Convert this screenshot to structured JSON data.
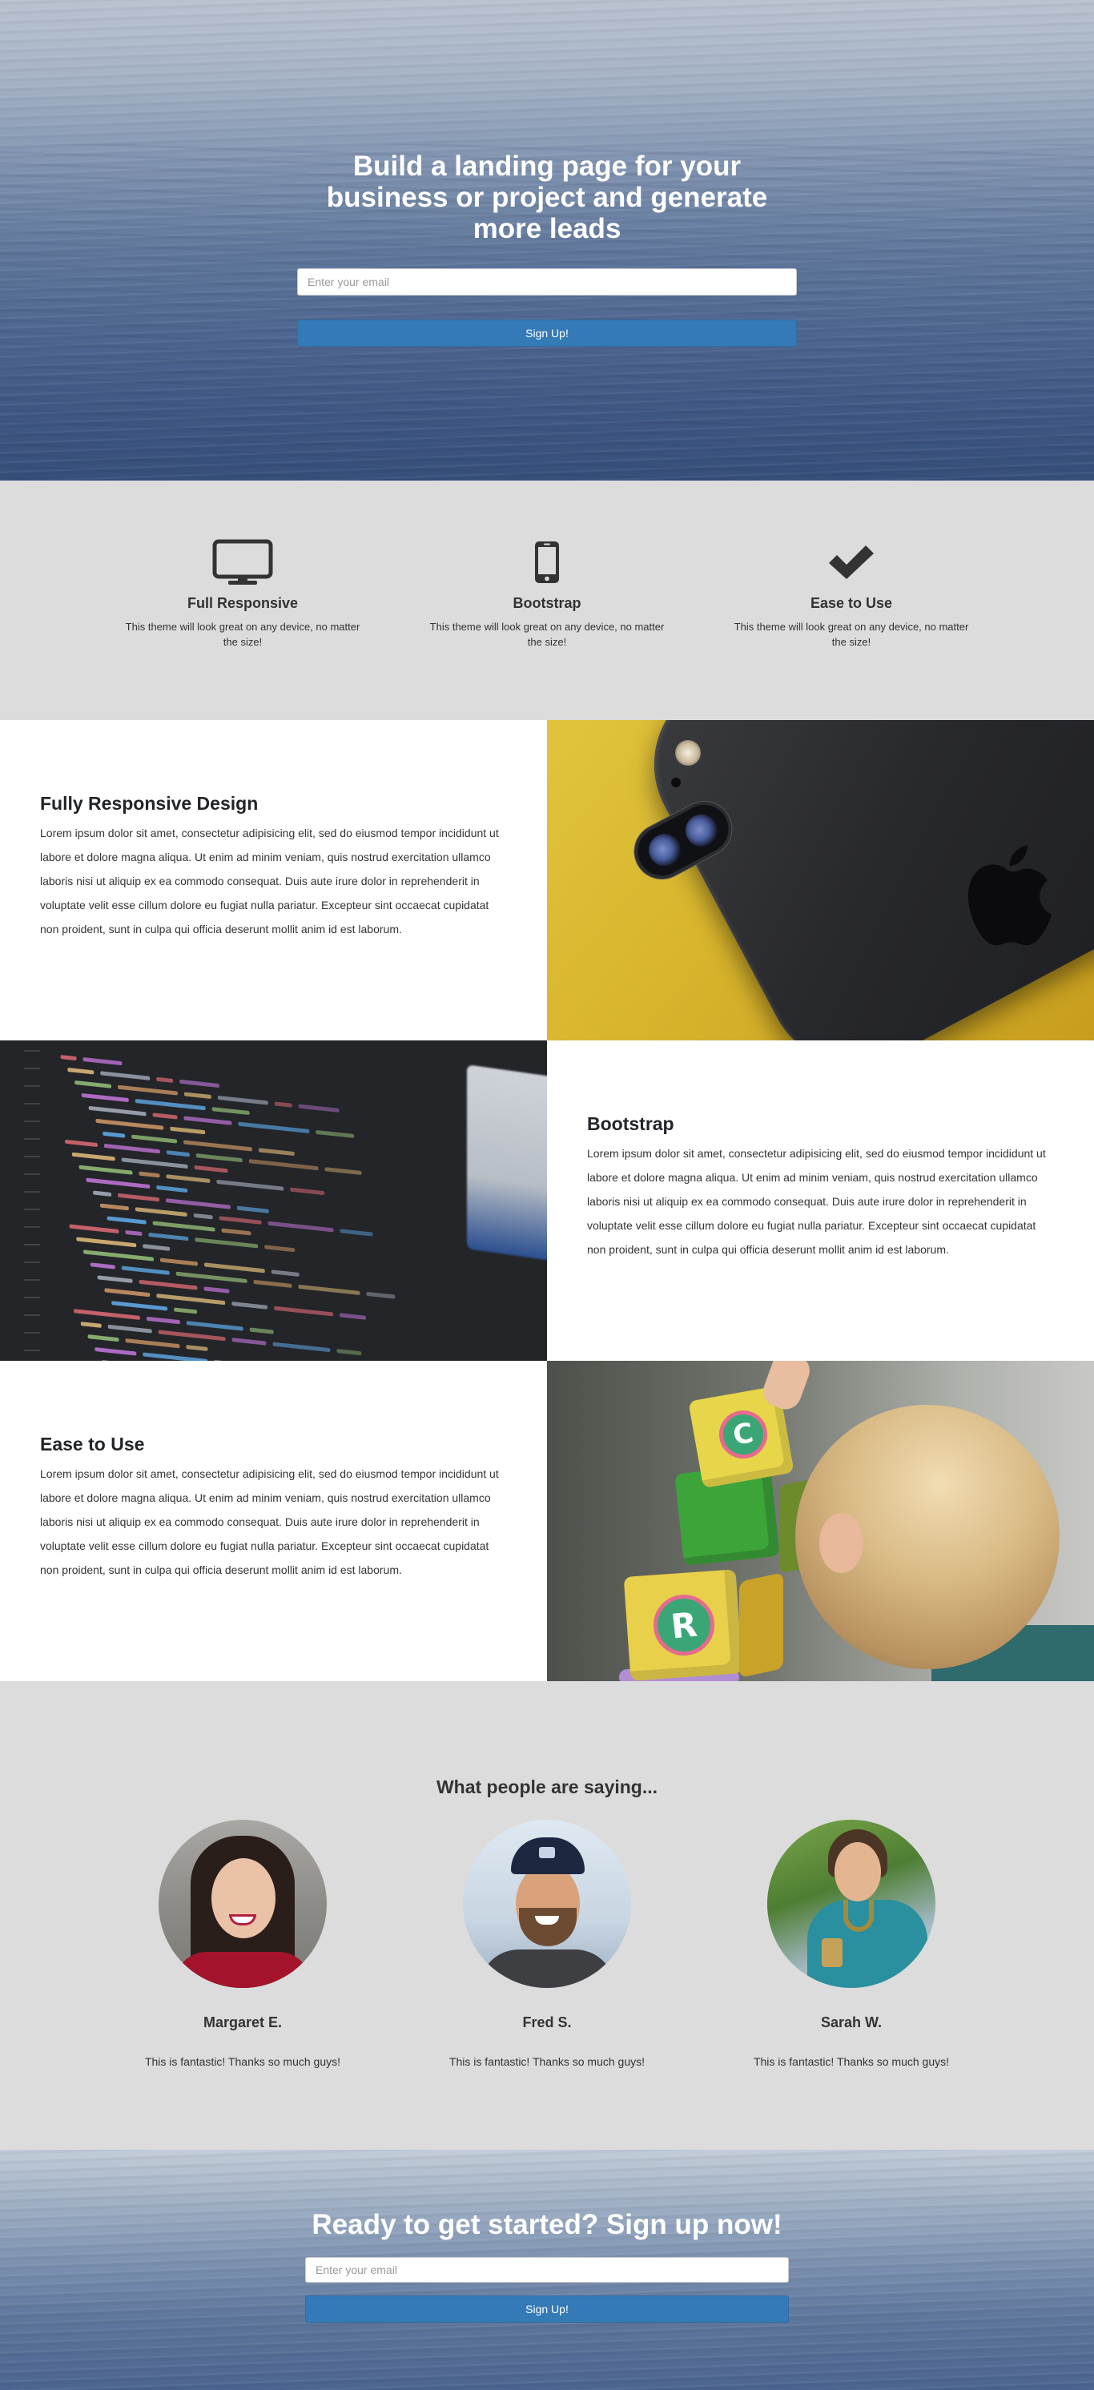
{
  "hero": {
    "title": "Build a landing page for your business or project and generate more leads",
    "email_placeholder": "Enter your email",
    "button_label": "Sign Up!"
  },
  "features": [
    {
      "icon": "monitor-icon",
      "title": "Full Responsive",
      "text": "This theme will look great on any device, no matter the size!"
    },
    {
      "icon": "mobile-phone-icon",
      "title": "Bootstrap",
      "text": "This theme will look great on any device, no matter the size!"
    },
    {
      "icon": "checkmark-icon",
      "title": "Ease to Use",
      "text": "This theme will look great on any device, no matter the size!"
    }
  ],
  "showcase": [
    {
      "title": "Fully Responsive Design",
      "text": "Lorem ipsum dolor sit amet, consectetur adipisicing elit, sed do eiusmod tempor incididunt ut labore et dolore magna aliqua. Ut enim ad minim veniam, quis nostrud exercitation ullamco laboris nisi ut aliquip ex ea commodo consequat. Duis aute irure dolor in reprehenderit in voluptate velit esse cillum dolore eu fugiat nulla pariatur. Excepteur sint occaecat cupidatat non proident, sunt in culpa qui officia deserunt mollit anim id est laborum."
    },
    {
      "title": "Bootstrap",
      "text": "Lorem ipsum dolor sit amet, consectetur adipisicing elit, sed do eiusmod tempor incididunt ut labore et dolore magna aliqua. Ut enim ad minim veniam, quis nostrud exercitation ullamco laboris nisi ut aliquip ex ea commodo consequat. Duis aute irure dolor in reprehenderit in voluptate velit esse cillum dolore eu fugiat nulla pariatur. Excepteur sint occaecat cupidatat non proident, sunt in culpa qui officia deserunt mollit anim id est laborum."
    },
    {
      "title": "Ease to Use",
      "text": "Lorem ipsum dolor sit amet, consectetur adipisicing elit, sed do eiusmod tempor incididunt ut labore et dolore magna aliqua. Ut enim ad minim veniam, quis nostrud exercitation ullamco laboris nisi ut aliquip ex ea commodo consequat. Duis aute irure dolor in reprehenderit in voluptate velit esse cillum dolore eu fugiat nulla pariatur. Excepteur sint occaecat cupidatat non proident, sunt in culpa qui officia deserunt mollit anim id est laborum."
    }
  ],
  "testimonials": {
    "title": "What people are saying...",
    "items": [
      {
        "name": "Margaret E.",
        "quote": "This is fantastic! Thanks so much guys!"
      },
      {
        "name": "Fred S.",
        "quote": "This is fantastic! Thanks so much guys!"
      },
      {
        "name": "Sarah W.",
        "quote": "This is fantastic! Thanks so much guys!"
      }
    ]
  },
  "cta": {
    "title": "Ready to get started? Sign up now!",
    "email_placeholder": "Enter your email",
    "button_label": "Sign Up!"
  },
  "colors": {
    "primary_button": "#337ab7",
    "section_gray": "#dcdcdc",
    "text_dark": "#333333"
  }
}
